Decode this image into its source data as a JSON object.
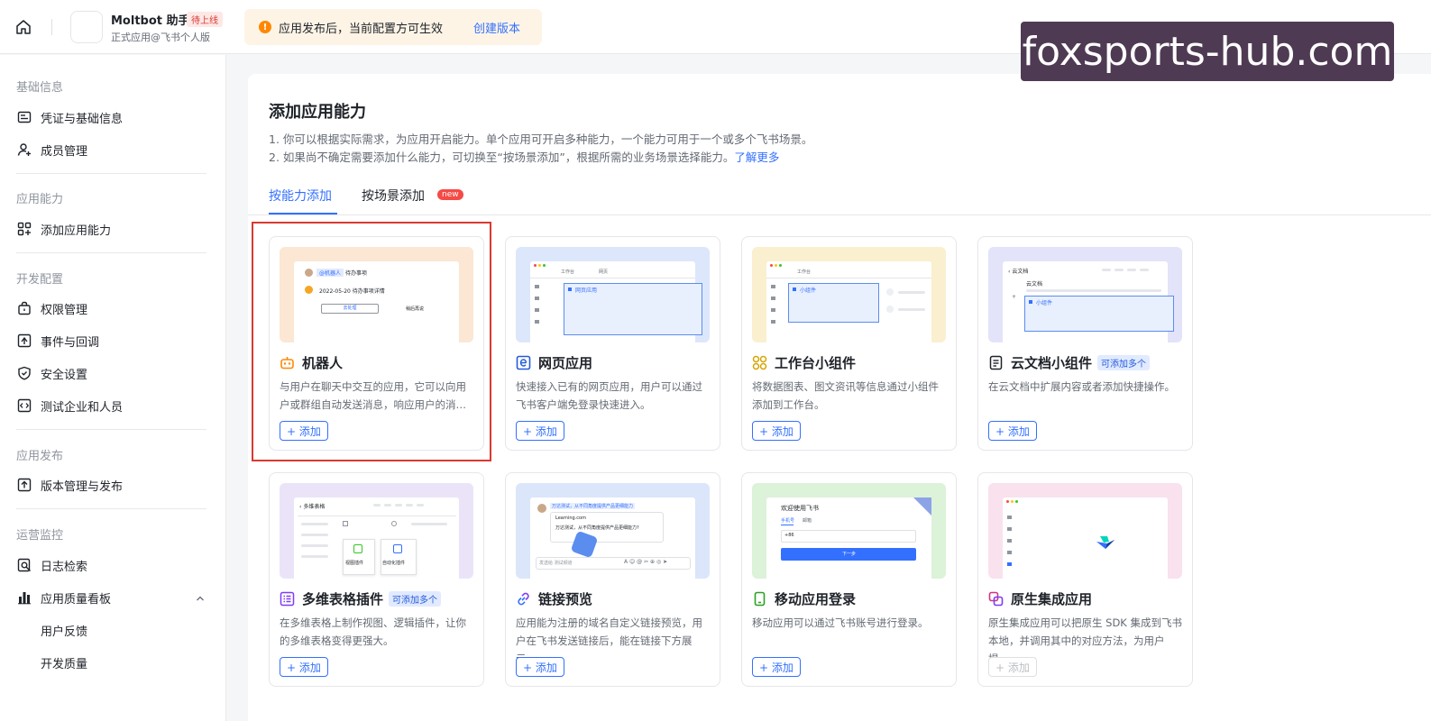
{
  "header": {
    "app_name": "Moltbot 助手",
    "app_badge": "待上线",
    "app_subtitle": "正式应用@飞书个人版",
    "notice_text": "应用发布后，当前配置方可生效",
    "notice_link": "创建版本",
    "watermark": "foxsports-hub.com"
  },
  "sidebar": {
    "sections": [
      {
        "title": "基础信息",
        "items": [
          {
            "label": "凭证与基础信息",
            "icon": "id-card-icon"
          },
          {
            "label": "成员管理",
            "icon": "add-user-icon"
          }
        ]
      },
      {
        "title": "应用能力",
        "items": [
          {
            "label": "添加应用能力",
            "icon": "apps-add-icon"
          }
        ]
      },
      {
        "title": "开发配置",
        "items": [
          {
            "label": "权限管理",
            "icon": "lock-bag-icon"
          },
          {
            "label": "事件与回调",
            "icon": "event-icon"
          },
          {
            "label": "安全设置",
            "icon": "shield-icon"
          },
          {
            "label": "测试企业和人员",
            "icon": "code-icon"
          }
        ]
      },
      {
        "title": "应用发布",
        "items": [
          {
            "label": "版本管理与发布",
            "icon": "upload-icon"
          }
        ]
      },
      {
        "title": "运营监控",
        "items": [
          {
            "label": "日志检索",
            "icon": "log-search-icon"
          },
          {
            "label": "应用质量看板",
            "icon": "bar-chart-icon"
          }
        ]
      }
    ],
    "subitems": [
      "用户反馈",
      "开发质量"
    ]
  },
  "main": {
    "title": "添加应用能力",
    "desc_line1": "1. 你可以根据实际需求，为应用开启能力。单个应用可开启多种能力，一个能力可用于一个或多个飞书场景。",
    "desc_line2": "2. 如果尚不确定需要添加什么能力，可切换至“按场景添加”，根据所需的业务场景选择能力。",
    "desc_link": "了解更多",
    "tabs": [
      {
        "label": "按能力添加",
        "active": true
      },
      {
        "label": "按场景添加",
        "badge": "new"
      }
    ],
    "cards": [
      {
        "title": "机器人",
        "desc": "与用户在聊天中交互的应用，它可以向用户或群组自动发送消息，响应用户的消…",
        "button": "+ 添加",
        "icon": "robot-icon",
        "color": "#fbe7d4",
        "disabled": false
      },
      {
        "title": "网页应用",
        "desc": "快速接入已有的网页应用，用户可以通过飞书客户端免登录快速进入。",
        "button": "+ 添加",
        "icon": "web-app-icon",
        "color": "#dde7fb",
        "disabled": false
      },
      {
        "title": "工作台小组件",
        "desc": "将数据图表、图文资讯等信息通过小组件添加到工作台。",
        "button": "+ 添加",
        "icon": "widget-icon",
        "color": "#faf0cf",
        "disabled": false
      },
      {
        "title": "云文档小组件",
        "tag": "可添加多个",
        "desc": "在云文档中扩展内容或者添加快捷操作。",
        "button": "+ 添加",
        "icon": "doc-icon",
        "color": "#e3e3fa",
        "disabled": false
      },
      {
        "title": "多维表格插件",
        "tag": "可添加多个",
        "desc": "在多维表格上制作视图、逻辑插件，让你的多维表格变得更强大。",
        "button": "+ 添加",
        "icon": "table-icon",
        "color": "#ebe4f9",
        "disabled": false
      },
      {
        "title": "链接预览",
        "desc": "应用能为注册的域名自定义链接预览，用户在飞书发送链接后，能在链接下方展示…",
        "button": "+ 添加",
        "icon": "link-icon",
        "color": "#dbe6fa",
        "disabled": false
      },
      {
        "title": "移动应用登录",
        "desc": "移动应用可以通过飞书账号进行登录。",
        "button": "+ 添加",
        "icon": "mobile-icon",
        "color": "#dcf2d9",
        "disabled": false
      },
      {
        "title": "原生集成应用",
        "desc": "原生集成应用可以把原生 SDK 集成到飞书本地，并调用其中的对应方法，为用户提…",
        "button": "+ 添加",
        "icon": "native-icon",
        "color": "#f9e1ee",
        "disabled": true
      }
    ],
    "mock": {
      "robot_chip": "@机器人",
      "robot_chip2": "待办事项",
      "robot_date": "2022-05-20 待办事项详情",
      "robot_btn": "去处理",
      "robot_btn2": "稍后再说",
      "web_tab1": "工作台",
      "web_tab2": "网页",
      "web_label": "网页应用",
      "widget_label": "小组件",
      "doc_back": "云文档",
      "doc_title": "云文档",
      "doc_label": "小组件",
      "base_back": "多维表格",
      "base_item1": "视图插件",
      "base_item2": "自动化插件",
      "link_msg": "万达测试，从不同角度提供产品更细能力",
      "link_url": "Learning.com",
      "link_sub": "万达测试，从不同角度提供产品更细能力?",
      "link_input": "发送给 测试频道",
      "mobile_welcome": "欢迎使用飞书",
      "mobile_tab1": "手机号",
      "mobile_tab2": "邮箱",
      "mobile_code": "+86",
      "mobile_next": "下一步"
    }
  }
}
